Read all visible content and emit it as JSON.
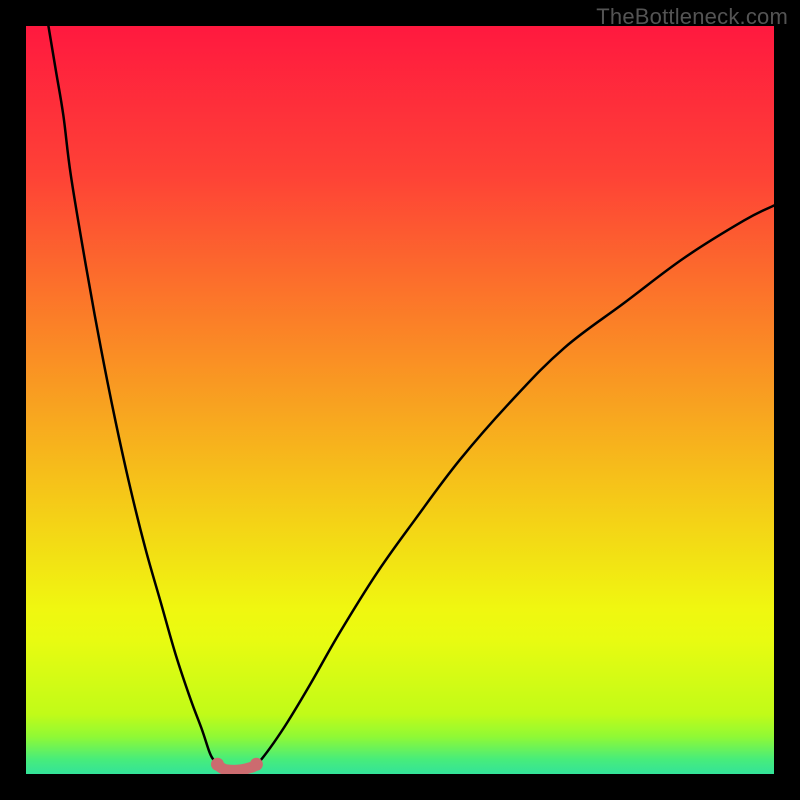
{
  "watermark": "TheBottleneck.com",
  "chart_data": {
    "type": "line",
    "title": "",
    "xlabel": "",
    "ylabel": "",
    "xlim": [
      0,
      100
    ],
    "ylim": [
      0,
      100
    ],
    "grid": false,
    "legend": false,
    "series": [
      {
        "name": "left-arc",
        "x": [
          3,
          4,
          5,
          6,
          8,
          10,
          12,
          14,
          16,
          18,
          20,
          22,
          23.5,
          24.5,
          25,
          25.6
        ],
        "values": [
          100,
          94,
          88,
          80,
          68,
          57,
          47,
          38,
          30,
          23,
          16,
          10,
          6,
          3,
          2,
          1.3
        ]
      },
      {
        "name": "right-arc",
        "x": [
          30.8,
          31.5,
          33,
          35,
          38,
          42,
          47,
          52,
          58,
          65,
          72,
          80,
          88,
          96,
          100
        ],
        "values": [
          1.3,
          2,
          4,
          7,
          12,
          19,
          27,
          34,
          42,
          50,
          57,
          63,
          69,
          74,
          76
        ]
      },
      {
        "name": "valley-pink",
        "x": [
          25.6,
          26,
          26.6,
          27.4,
          28.2,
          29,
          29.8,
          30.4,
          30.8
        ],
        "values": [
          1.3,
          0.9,
          0.6,
          0.5,
          0.5,
          0.6,
          0.8,
          1.0,
          1.3
        ]
      }
    ],
    "background_gradient": {
      "stops": [
        {
          "offset": 0.0,
          "color": "#ff193f"
        },
        {
          "offset": 0.2,
          "color": "#fe4236"
        },
        {
          "offset": 0.4,
          "color": "#fb8127"
        },
        {
          "offset": 0.6,
          "color": "#f6bf1a"
        },
        {
          "offset": 0.78,
          "color": "#f0f710"
        },
        {
          "offset": 0.82,
          "color": "#e9fb11"
        },
        {
          "offset": 0.92,
          "color": "#c1fb18"
        },
        {
          "offset": 0.95,
          "color": "#90f935"
        },
        {
          "offset": 0.98,
          "color": "#48ed7a"
        },
        {
          "offset": 1.0,
          "color": "#33e39a"
        }
      ]
    },
    "curve_color": "#000000",
    "curve_width": 2.5,
    "valley_color": "#cc6b6f",
    "valley_width": 11
  }
}
